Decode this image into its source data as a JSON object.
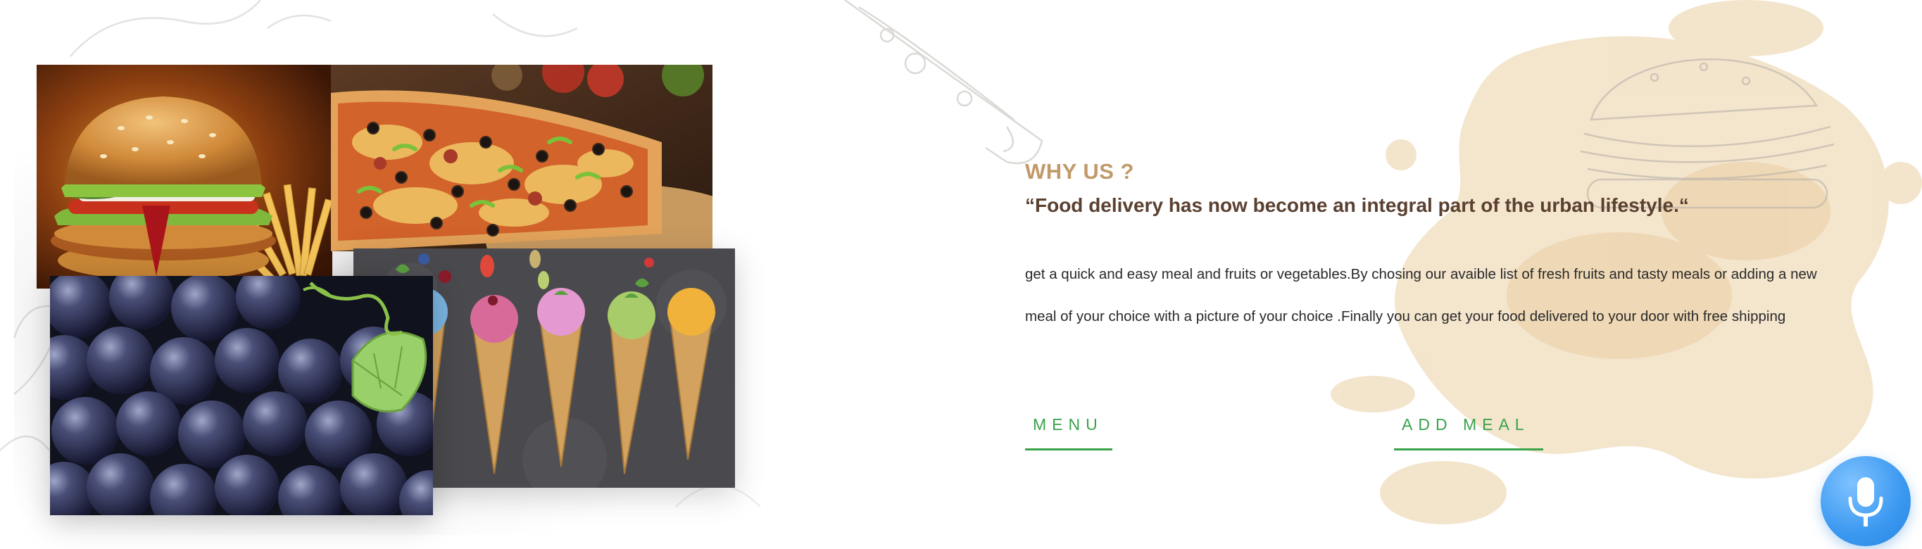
{
  "section": {
    "eyebrow": "WHY US ?",
    "quote": "“Food delivery has now become an integral part of the urban lifestyle.“",
    "body": "get a quick and easy meal and fruits or vegetables.By chosing our avaible list of fresh fruits and tasty meals or adding a new meal of your choice with a picture of your choice .Finally you can get your food delivered to your door with free shipping"
  },
  "buttons": {
    "menu_label": "MENU",
    "add_meal_label": "ADD MEAL"
  },
  "images": [
    {
      "name": "burger-photo",
      "subject": "burger with fries"
    },
    {
      "name": "pizza-photo",
      "subject": "pizza"
    },
    {
      "name": "grapes-photo",
      "subject": "grapes with leaf"
    },
    {
      "name": "icecream-photo",
      "subject": "ice cream cones"
    }
  ],
  "icons": {
    "mic": "microphone-icon"
  },
  "colors": {
    "accent_gold": "#c19a6b",
    "quote_brown": "#5a4030",
    "link_green": "#3aa34a",
    "mic_blue": "#3a98f0",
    "splash_beige": "#ecd4b0"
  }
}
